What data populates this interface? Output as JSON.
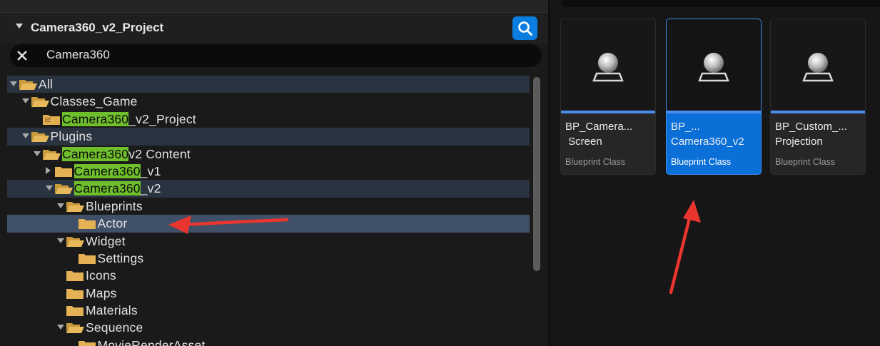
{
  "browser": {
    "project_title": "Camera360_v2_Project",
    "search": {
      "value": "Camera360",
      "icon": "search-icon",
      "accent_color": "#0a7de0"
    },
    "highlight_color": "#6fbe2c",
    "tree": [
      {
        "pre": "",
        "hit": "",
        "post": "All",
        "depth": 0,
        "expander": "down",
        "folder": "open",
        "row_state": "hl"
      },
      {
        "pre": "",
        "hit": "",
        "post": "Classes_Game",
        "depth": 1,
        "expander": "down",
        "folder": "open",
        "row_state": ""
      },
      {
        "pre": "",
        "hit": "Camera360",
        "post": "_v2_Project",
        "depth": 2,
        "expander": "none",
        "folder": "cpp",
        "row_state": ""
      },
      {
        "pre": "",
        "hit": "",
        "post": "Plugins",
        "depth": 1,
        "expander": "down",
        "folder": "open",
        "row_state": "hl"
      },
      {
        "pre": "",
        "hit": "Camera360",
        "post": "v2 Content",
        "depth": 2,
        "expander": "down",
        "folder": "open",
        "row_state": ""
      },
      {
        "pre": "",
        "hit": "Camera360",
        "post": "_v1",
        "depth": 3,
        "expander": "right",
        "folder": "closed",
        "row_state": ""
      },
      {
        "pre": "",
        "hit": "Camera360",
        "post": "_v2",
        "depth": 3,
        "expander": "down",
        "folder": "open",
        "row_state": "hl"
      },
      {
        "pre": "",
        "hit": "",
        "post": "Blueprints",
        "depth": 4,
        "expander": "down",
        "folder": "open",
        "row_state": ""
      },
      {
        "pre": "",
        "hit": "",
        "post": "Actor",
        "depth": 5,
        "expander": "none",
        "folder": "closed",
        "row_state": "sel"
      },
      {
        "pre": "",
        "hit": "",
        "post": "Widget",
        "depth": 4,
        "expander": "down",
        "folder": "open",
        "row_state": ""
      },
      {
        "pre": "",
        "hit": "",
        "post": "Settings",
        "depth": 5,
        "expander": "none",
        "folder": "closed",
        "row_state": ""
      },
      {
        "pre": "",
        "hit": "",
        "post": "Icons",
        "depth": 4,
        "expander": "none",
        "folder": "closed",
        "row_state": ""
      },
      {
        "pre": "",
        "hit": "",
        "post": "Maps",
        "depth": 4,
        "expander": "none",
        "folder": "closed",
        "row_state": ""
      },
      {
        "pre": "",
        "hit": "",
        "post": "Materials",
        "depth": 4,
        "expander": "none",
        "folder": "closed",
        "row_state": ""
      },
      {
        "pre": "",
        "hit": "",
        "post": "Sequence",
        "depth": 4,
        "expander": "down",
        "folder": "open",
        "row_state": ""
      },
      {
        "pre": "",
        "hit": "",
        "post": "MovieRenderAsset",
        "depth": 5,
        "expander": "none",
        "folder": "closed",
        "row_state": ""
      }
    ]
  },
  "assets": [
    {
      "name": "BP_Camera...\n Screen",
      "type": "Blueprint Class",
      "selected": false,
      "icon": "actor-sphere-icon"
    },
    {
      "name": "BP_...\nCamera360_v2",
      "type": "Blueprint Class",
      "selected": true,
      "icon": "actor-sphere-icon"
    },
    {
      "name": "BP_Custom_...\nProjection",
      "type": "Blueprint Class",
      "selected": false,
      "icon": "actor-sphere-icon"
    }
  ],
  "annotations": {
    "color": "#e8362f"
  }
}
